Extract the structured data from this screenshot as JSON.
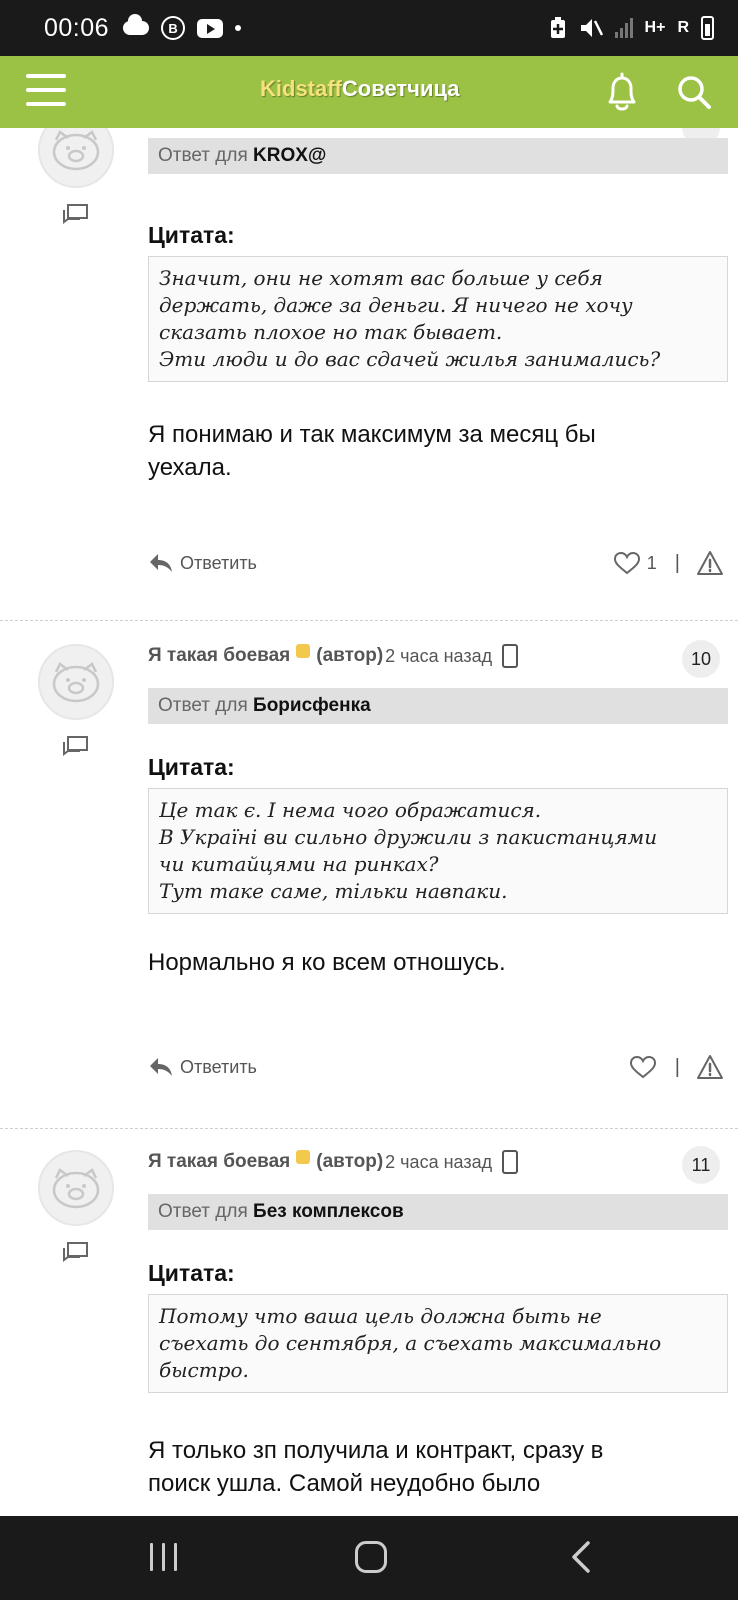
{
  "status": {
    "time": "00:06",
    "b_badge": "B",
    "network_label": "H+",
    "roaming_label": "R"
  },
  "header": {
    "logo_part1": "Kidstaff",
    "logo_part2": "Советчица",
    "icons": [
      "menu-icon",
      "bell-icon",
      "search-icon"
    ],
    "colors": {
      "bar": "#9bc145",
      "logo_accent": "#f5e27a"
    }
  },
  "posts": [
    {
      "reply_prefix": "Ответ для",
      "reply_to": "KROX@",
      "quote_label": "Цитата:",
      "quote_lines": [
        "Значит, они не хотят вас больше у себя",
        "держать, даже за деньги. Я ничего не хочу",
        "сказать плохое но так бывает.",
        "Эти люди и до вас сдачей жилья занимались?"
      ],
      "body_lines": [
        "Я понимаю и так максимум за месяц бы",
        "уехала."
      ],
      "reply_label": "Ответить",
      "likes": "1",
      "separator": "|"
    },
    {
      "author": "Я такая боевая",
      "role": "(автор)",
      "time": "2 часа назад",
      "number": "10",
      "reply_prefix": "Ответ для",
      "reply_to": "Борисфенка",
      "quote_label": "Цитата:",
      "quote_lines": [
        "Це так є. І нема чого ображатися.",
        "В Україні ви сильно дружили з пакистанцями",
        "чи китайцями на ринках?",
        "Тут таке саме, тільки навпаки."
      ],
      "body_lines": [
        "Нормально я ко всем отношусь."
      ],
      "reply_label": "Ответить",
      "separator": "|"
    },
    {
      "author": "Я такая боевая",
      "role": "(автор)",
      "time": "2 часа назад",
      "number": "11",
      "reply_prefix": "Ответ для",
      "reply_to": "Без комплексов",
      "quote_label": "Цитата:",
      "quote_lines": [
        "Потому что ваша цель должна быть не",
        "съехать до сентября, а съехать максимально",
        "быстро."
      ],
      "body_lines": [
        "Я только зп получила и контракт, сразу в",
        "поиск ушла. Самой неудобно было"
      ]
    }
  ]
}
